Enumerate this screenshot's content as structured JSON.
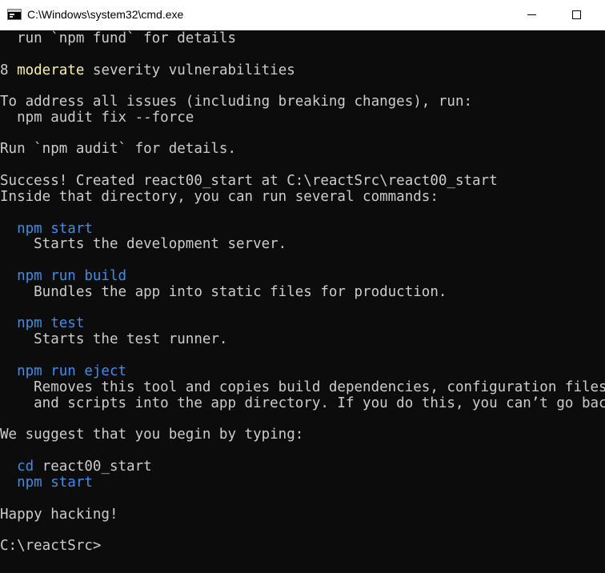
{
  "window": {
    "title": "C:\\Windows\\system32\\cmd.exe",
    "controls": [
      "minimize",
      "maximize"
    ]
  },
  "colors": {
    "background": "#0c0c0c",
    "foreground": "#cccccc",
    "highlight_yellow": "#f9f1a5",
    "command_blue": "#3b8eea"
  },
  "console": {
    "lines": {
      "l01": "  run `npm fund` for details",
      "l03a": "8 ",
      "l03b": "moderate",
      "l03c": " severity vulnerabilities",
      "l05": "To address all issues (including breaking changes), run:",
      "l06": "  npm audit fix --force",
      "l08": "Run `npm audit` for details.",
      "l10": "Success! Created react00_start at C:\\reactSrc\\react00_start",
      "l11": "Inside that directory, you can run several commands:",
      "l13": "  npm start",
      "l14": "    Starts the development server.",
      "l16": "  npm run build",
      "l17": "    Bundles the app into static files for production.",
      "l19": "  npm test",
      "l20": "    Starts the test runner.",
      "l22": "  npm run eject",
      "l23": "    Removes this tool and copies build dependencies, configuration files",
      "l24": "    and scripts into the app directory. If you do this, you can’t go back!",
      "l26": "We suggest that you begin by typing:",
      "l28a": "  cd",
      "l28b": " react00_start",
      "l29": "  npm start",
      "l31": "Happy hacking!",
      "l33": "C:\\reactSrc>"
    }
  }
}
